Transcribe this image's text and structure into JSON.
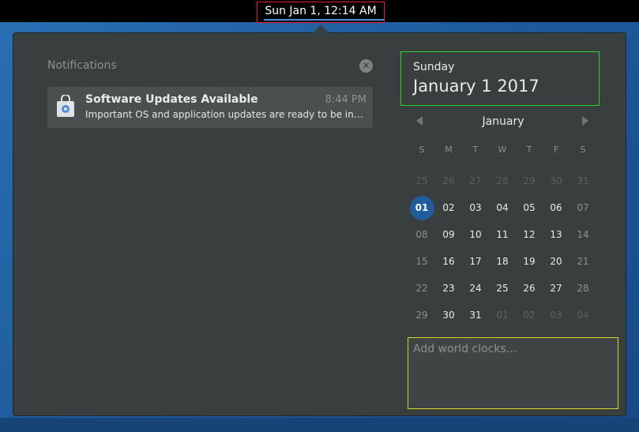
{
  "topbar": {
    "clock": "Sun Jan  1, 12:14 AM"
  },
  "notifications": {
    "title": "Notifications",
    "clear_icon": "close-circle-icon",
    "items": [
      {
        "icon": "software-update-bag-icon",
        "heading": "Software Updates Available",
        "time": "8:44 PM",
        "body": "Important OS and application updates are ready to be install..."
      }
    ]
  },
  "date_panel": {
    "weekday": "Sunday",
    "full_date": "January  1 2017"
  },
  "calendar": {
    "month": "January",
    "prev_icon": "chevron-left-icon",
    "next_icon": "chevron-right-icon",
    "weekdays": [
      "S",
      "M",
      "T",
      "W",
      "T",
      "F",
      "S"
    ],
    "days": [
      [
        "25",
        "26",
        "27",
        "28",
        "29",
        "30",
        "31"
      ],
      [
        "01",
        "02",
        "03",
        "04",
        "05",
        "06",
        "07"
      ],
      [
        "08",
        "09",
        "10",
        "11",
        "12",
        "13",
        "14"
      ],
      [
        "15",
        "16",
        "17",
        "18",
        "19",
        "20",
        "21"
      ],
      [
        "22",
        "23",
        "24",
        "25",
        "26",
        "27",
        "28"
      ],
      [
        "29",
        "30",
        "31",
        "01",
        "02",
        "03",
        "04"
      ]
    ],
    "today": "01",
    "accent_color": "#215d9c"
  },
  "world_clocks": {
    "placeholder": "Add world clocks…"
  }
}
